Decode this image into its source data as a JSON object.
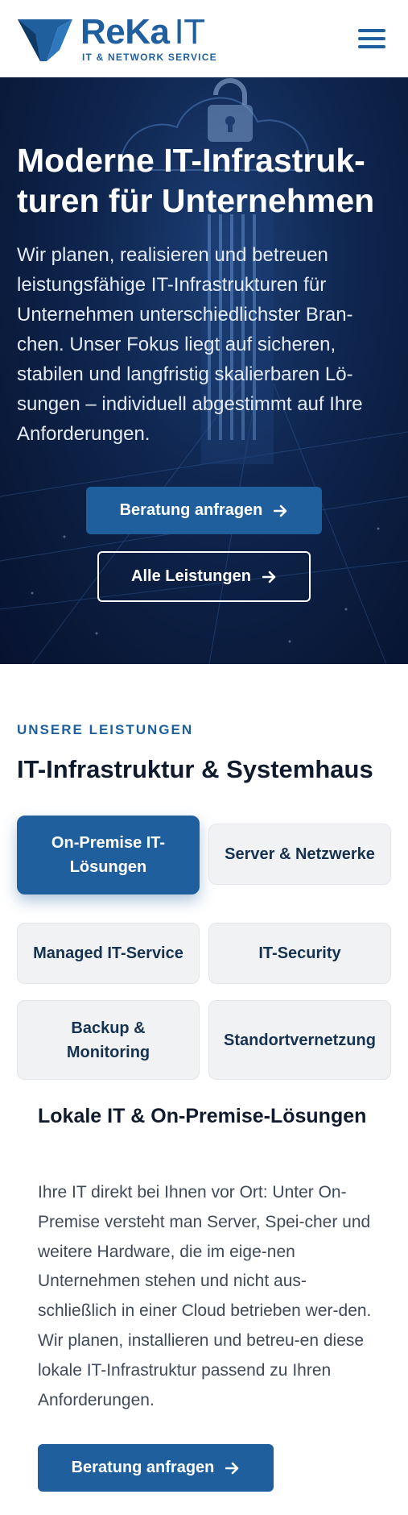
{
  "brand": {
    "name": "ReKa",
    "name_suffix": "IT",
    "tagline": "IT & NETWORK SERVICE",
    "color": "#1f5f9e"
  },
  "header": {
    "menu_icon": "hamburger-menu-icon"
  },
  "hero": {
    "title": "Moderne IT-Infrastruk-turen für Unternehmen",
    "text": "Wir planen, realisieren und betreuen leistungsfähige IT-Infrastrukturen für Unternehmen unterschiedlichster Bran-chen. Unser Fokus liegt auf sicheren, stabilen und langfristig skalierbaren Lö-sungen – individuell abgestimmt auf Ihre Anforderungen.",
    "primary_button": "Beratung anfragen",
    "secondary_button": "Alle Leistungen",
    "background_color": "#0c1f45"
  },
  "services": {
    "eyebrow": "UNSERE LEISTUNGEN",
    "title": "IT-Infrastruktur & Systemhaus",
    "tabs": [
      {
        "label": "On-Premise IT-Lösungen",
        "active": true
      },
      {
        "label": "Server & Netzwerke",
        "active": false
      },
      {
        "label": "Managed IT-Service",
        "active": false
      },
      {
        "label": "IT-Security",
        "active": false
      },
      {
        "label": "Backup & Monitoring",
        "active": false
      },
      {
        "label": "Standortvernetzung",
        "active": false
      }
    ],
    "detail": {
      "title": "Lokale IT & On-Premise-Lösungen",
      "text": "Ihre IT direkt bei Ihnen vor Ort: Unter On-Premise versteht man Server, Spei-cher und weitere Hardware, die im eige-nen Unternehmen stehen und nicht aus-schließlich in einer Cloud betrieben wer-den. Wir planen, installieren und betreu-en diese lokale IT-Infrastruktur passend zu Ihren Anforderungen.",
      "button": "Beratung anfragen"
    }
  }
}
